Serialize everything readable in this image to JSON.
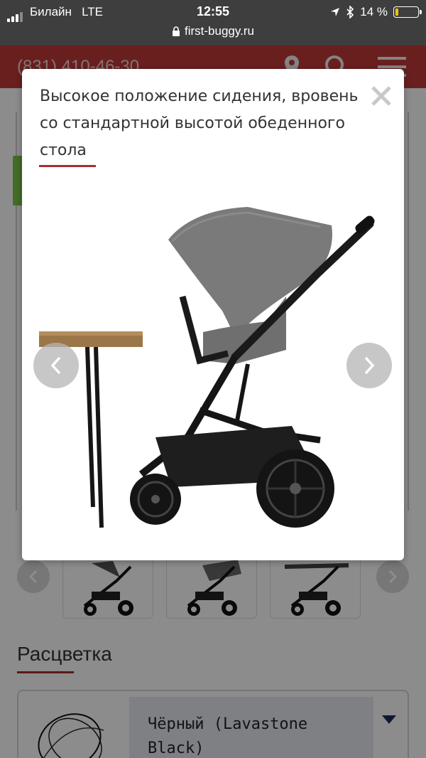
{
  "status_bar": {
    "carrier": "Билайн",
    "network": "LTE",
    "time": "12:55",
    "battery_text": "14 %",
    "battery_level": 0.14,
    "battery_color": "#f4c20d"
  },
  "url_bar": {
    "url": "first-buggy.ru",
    "lock_icon": "lock-icon"
  },
  "site_header": {
    "phone": "(831) 410-46-30",
    "brand_color": "#c23a3a",
    "icons": [
      "location-pin-icon",
      "search-icon",
      "hamburger-menu-icon"
    ]
  },
  "modal": {
    "title": "Высокое положение сидения, вровень со стандартной высотой обеденного стола",
    "close_icon": "close-icon",
    "prev_icon": "chevron-left-icon",
    "next_icon": "chevron-right-icon",
    "accent_color": "#a62f2f"
  },
  "gallery": {
    "thumbnail_count": 3,
    "prev_icon": "chevron-left-icon",
    "next_icon": "chevron-right-icon"
  },
  "color_section": {
    "title": "Расцветка",
    "selected_color": "Чёрный (Lavastone Black)",
    "dropdown_icon": "triangle-down-icon"
  }
}
